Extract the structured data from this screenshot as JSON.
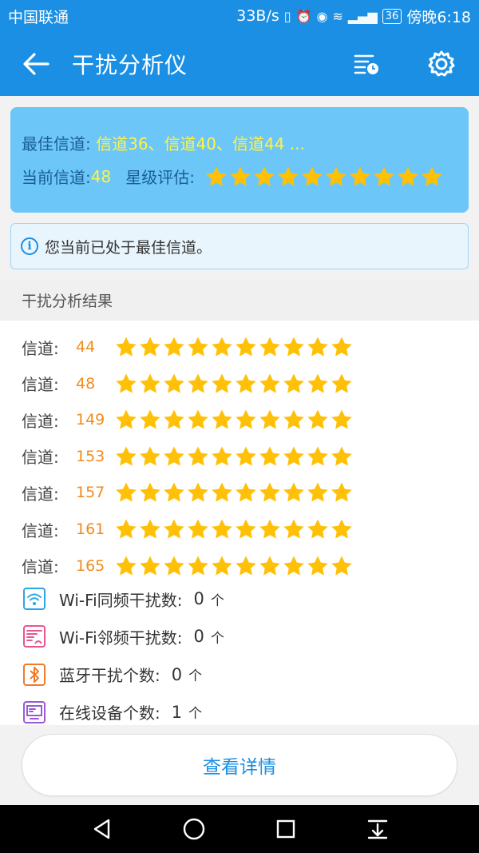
{
  "status_bar": {
    "carrier": "中国联通",
    "net_speed": "33B/s",
    "battery": "36",
    "time": "傍晚6:18",
    "icons": [
      "vibrate-icon",
      "alarm-icon",
      "eye-icon",
      "wifi-icon",
      "4g-signal-icon",
      "battery-icon"
    ]
  },
  "app_bar": {
    "title": "干扰分析仪",
    "back_icon": "arrow-left-icon",
    "history_icon": "history-list-icon",
    "settings_icon": "gear-icon"
  },
  "summary": {
    "best_label": "最佳信道: ",
    "best_value": "信道36、信道40、信道44 ...",
    "current_label": "当前信道: ",
    "current_value": "48",
    "rating_label": "星级评估:",
    "rating_stars": 10
  },
  "notice": {
    "icon": "info-icon",
    "text": "您当前已处于最佳信道。"
  },
  "results": {
    "title": "干扰分析结果",
    "channel_label": "信道:",
    "channels": [
      {
        "num": "44",
        "stars": 10
      },
      {
        "num": "48",
        "stars": 10
      },
      {
        "num": "149",
        "stars": 10
      },
      {
        "num": "153",
        "stars": 10
      },
      {
        "num": "157",
        "stars": 10
      },
      {
        "num": "161",
        "stars": 10
      },
      {
        "num": "165",
        "stars": 10
      }
    ],
    "stats": [
      {
        "icon": "wifi-icon",
        "label": "Wi-Fi同频干扰数:",
        "value": "0",
        "unit": "个",
        "color": "#2aa7e8"
      },
      {
        "icon": "wifi-adjacent-icon",
        "label": "Wi-Fi邻频干扰数:",
        "value": "0",
        "unit": "个",
        "color": "#e8558f"
      },
      {
        "icon": "bluetooth-icon",
        "label": "蓝牙干扰个数:",
        "value": "0",
        "unit": "个",
        "color": "#f07a2a"
      },
      {
        "icon": "device-icon",
        "label": "在线设备个数:",
        "value": "1",
        "unit": "个",
        "color": "#9a5ad6"
      }
    ]
  },
  "detail_button": {
    "label": "查看详情"
  },
  "nav_bar": {
    "icons": [
      "back-triangle-icon",
      "home-circle-icon",
      "recents-square-icon",
      "notification-pull-icon"
    ]
  },
  "colors": {
    "primary": "#1a8fe3",
    "star": "#ffc107",
    "channel_num": "#f08c1c",
    "summary_bg": "#6cc6f7"
  }
}
